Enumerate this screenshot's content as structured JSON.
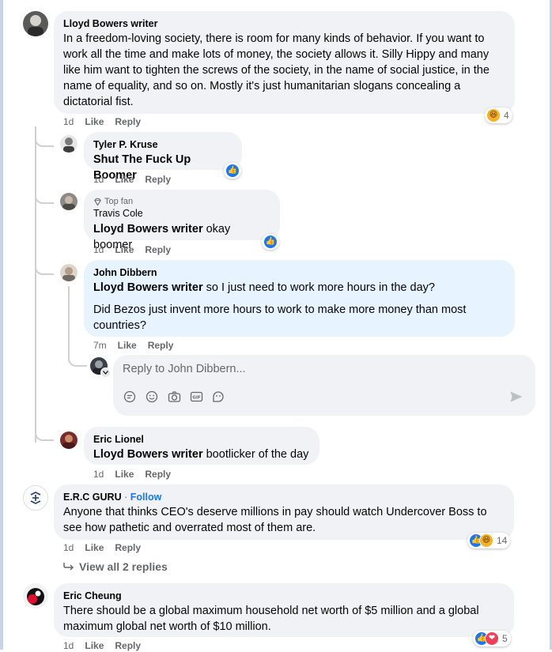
{
  "comments": [
    {
      "author": "Lloyd Bowers writer",
      "text": "In a freedom-loving society, there is room for many kinds of behavior. If you want to work all the time and make lots of money, the society allows it. Silly Hippy and many like him want to tighten the screws of the society, in the name of social justice, in the name of equality, and so on. Mostly it's just humanitarian slogans concealing a dictatorial fist.",
      "time": "1d",
      "like": "Like",
      "reply": "Reply",
      "reaction_count": "4"
    },
    {
      "author": "Tyler P. Kruse",
      "text": "Shut The Fuck Up Boomer",
      "time": "1d",
      "like": "Like",
      "reply": "Reply"
    },
    {
      "badge": "Top fan",
      "author": "Travis Cole",
      "mention": "Lloyd Bowers writer",
      "text": " okay boomer",
      "time": "1d",
      "like": "Like",
      "reply": "Reply"
    },
    {
      "author": "John Dibbern",
      "mention": "Lloyd Bowers writer",
      "text": " so I just need to work more hours in the day?",
      "text2": "Did Bezos just invent more hours to work to make more money than most countries?",
      "time": "7m",
      "like": "Like",
      "reply": "Reply"
    },
    {
      "author": "Eric Lionel",
      "mention": "Lloyd Bowers writer",
      "text": " bootlicker of the day",
      "time": "1d",
      "like": "Like",
      "reply": "Reply"
    },
    {
      "author": "E.R.C GURU",
      "follow": "Follow",
      "text": "Anyone that thinks CEO's deserve millions in pay should watch Undercover Boss to see how pathetic and overrated most of them are.",
      "time": "1d",
      "like": "Like",
      "reply": "Reply",
      "reaction_count": "14"
    },
    {
      "author": "Eric Cheung",
      "text": "There should be a global maximum household net worth of $5 million and a global maximum global net worth of $10 million.",
      "time": "1d",
      "like": "Like",
      "reply": "Reply",
      "reaction_count": "5"
    }
  ],
  "reply_box": {
    "placeholder": "Reply to John Dibbern..."
  },
  "view_replies": "View all 2 replies",
  "colors": {
    "like": "#1877f2",
    "haha": "#f7b125",
    "love": "#f33e58",
    "bubble": "#f0f2f5",
    "highlight": "#e7f3ff"
  },
  "icons": [
    "like-icon",
    "haha-icon",
    "love-icon",
    "sticker-icon",
    "emoji-icon",
    "camera-icon",
    "gif-icon",
    "avatar-sticker-icon",
    "send-icon",
    "reply-arrow-icon",
    "diamond-icon"
  ]
}
